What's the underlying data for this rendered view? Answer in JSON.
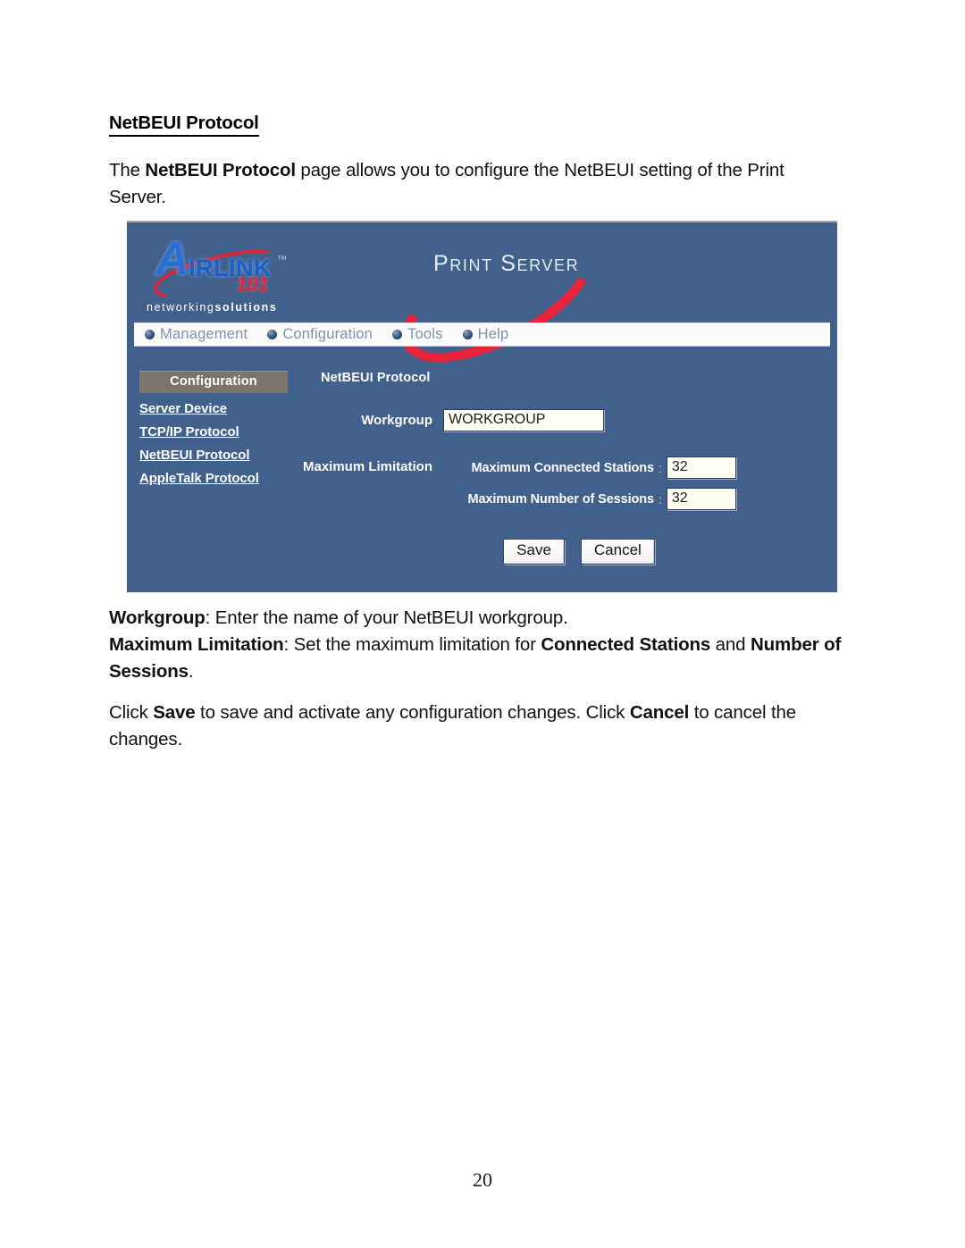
{
  "document": {
    "heading": "NetBEUI Protocol",
    "intro": {
      "before": "The ",
      "bold": "NetBEUI Protocol",
      "after": " page allows you to configure the NetBEUI setting of the Print Server."
    },
    "description": {
      "line1_bold": "Workgroup",
      "line1_rest": ": Enter the name of your NetBEUI workgroup.",
      "line2_bold": "Maximum Limitation",
      "line2_mid": ": Set the maximum limitation for ",
      "line2_bold2": "Connected Stations",
      "line2_and": " and ",
      "line2_bold3": "Number of Sessions",
      "line2_end": "."
    },
    "action": {
      "p1": "Click ",
      "b1": "Save",
      "p2": " to save and activate any configuration changes. Click ",
      "b2": "Cancel",
      "p3": " to cancel the changes."
    },
    "page_number": "20"
  },
  "screenshot": {
    "brand": {
      "logo_a": "A",
      "logo_rest": "IRLINK",
      "logo_tm": "™",
      "logo_101": "101",
      "tagline_thin": "networking",
      "tagline_bold": "solutions",
      "product_title": "Print Server"
    },
    "nav": {
      "items": [
        {
          "label": "Management",
          "icon": "sphere-bullet-icon"
        },
        {
          "label": "Configuration",
          "icon": "sphere-bullet-icon"
        },
        {
          "label": "Tools",
          "icon": "sphere-bullet-icon"
        },
        {
          "label": "Help",
          "icon": "sphere-bullet-icon"
        }
      ]
    },
    "sidebar": {
      "header": "Configuration",
      "links": [
        "Server Device",
        "TCP/IP Protocol",
        "NetBEUI Protocol",
        "AppleTalk Protocol"
      ]
    },
    "main": {
      "title": "NetBEUI Protocol",
      "workgroup_label": "Workgroup",
      "workgroup_value": "WORKGROUP",
      "limitation_label": "Maximum Limitation",
      "limits": [
        {
          "name": "Maximum Connected Stations",
          "separator": ":",
          "value": "32"
        },
        {
          "name": "Maximum Number of Sessions",
          "separator": ":",
          "value": "32"
        }
      ],
      "save_label": "Save",
      "cancel_label": "Cancel"
    },
    "colors": {
      "panel_blue": "#41608c",
      "accent_red": "#e0243c",
      "logo_blue": "#1d5fc4",
      "sidebar_header": "#7b746a",
      "input_bg": "#fffef2"
    }
  }
}
